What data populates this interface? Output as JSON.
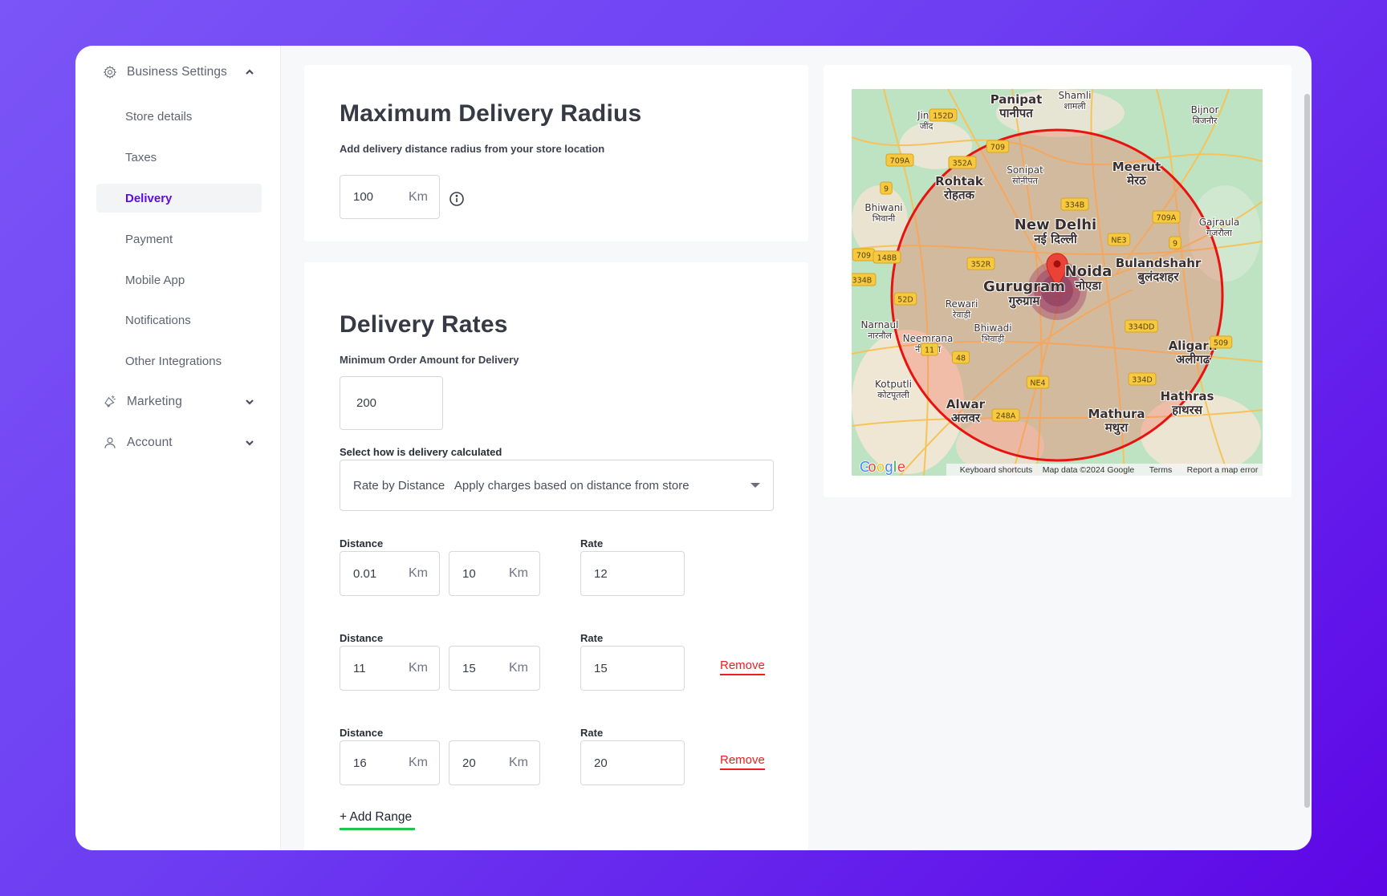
{
  "sidebar": {
    "groups": [
      {
        "label": "Business Settings",
        "icon": "gear-icon",
        "expanded": true
      },
      {
        "label": "Marketing",
        "icon": "megaphone-icon",
        "expanded": false
      },
      {
        "label": "Account",
        "icon": "user-icon",
        "expanded": false
      }
    ],
    "items": [
      {
        "label": "Store details",
        "active": false
      },
      {
        "label": "Taxes",
        "active": false
      },
      {
        "label": "Delivery",
        "active": true
      },
      {
        "label": "Payment",
        "active": false
      },
      {
        "label": "Mobile App",
        "active": false
      },
      {
        "label": "Notifications",
        "active": false
      },
      {
        "label": "Other Integrations",
        "active": false
      }
    ]
  },
  "radius_card": {
    "title": "Maximum Delivery Radius",
    "subtitle": "Add delivery distance radius from your store location",
    "radius_value": "100",
    "unit": "Km",
    "info_icon": "info-icon"
  },
  "rates_card": {
    "title": "Delivery Rates",
    "min_order_label": "Minimum Order Amount for Delivery",
    "min_order_value": "200",
    "calc_label": "Select how is delivery calculated",
    "calc_selected": "Rate by Distance   Apply charges based on distance from store",
    "distance_label": "Distance",
    "rate_label": "Rate",
    "unit": "Km",
    "remove_label": "Remove",
    "add_range_label": "+ Add Range",
    "ranges": [
      {
        "from": "0.01",
        "to": "10",
        "rate": "12",
        "removable": false
      },
      {
        "from": "11",
        "to": "15",
        "rate": "15",
        "removable": true
      },
      {
        "from": "16",
        "to": "20",
        "rate": "20",
        "removable": true
      }
    ]
  },
  "map": {
    "cities": [
      {
        "en": "Panipat",
        "hi": "पानीपत"
      },
      {
        "en": "Shamli",
        "hi": "शामली"
      },
      {
        "en": "Jind",
        "hi": "जींद"
      },
      {
        "en": "Bijnor",
        "hi": "बिजनौर"
      },
      {
        "en": "Sonipat",
        "hi": "सोनीपत"
      },
      {
        "en": "Rohtak",
        "hi": "रोहतक"
      },
      {
        "en": "Meerut",
        "hi": "मेरठ"
      },
      {
        "en": "Bhiwani",
        "hi": "भिवानी"
      },
      {
        "en": "New Delhi",
        "hi": "नई दिल्ली"
      },
      {
        "en": "Gajraula",
        "hi": "गजरौला"
      },
      {
        "en": "Noida",
        "hi": "नोएडा"
      },
      {
        "en": "Gurugram",
        "hi": "गुरुग्राम"
      },
      {
        "en": "Bulandshahr",
        "hi": "बुलंदशहर"
      },
      {
        "en": "Rewari",
        "hi": "रेवाड़ी"
      },
      {
        "en": "Narnaul",
        "hi": "नारनौल"
      },
      {
        "en": "Bhiwadi",
        "hi": "भिवाड़ी"
      },
      {
        "en": "Neemrana",
        "hi": "नीमराना"
      },
      {
        "en": "Aligarh",
        "hi": "अलीगढ"
      },
      {
        "en": "Kotputli",
        "hi": "कोटपूतली"
      },
      {
        "en": "Alwar",
        "hi": "अलवर"
      },
      {
        "en": "Hathras",
        "hi": "हाथरस"
      },
      {
        "en": "Mathura",
        "hi": "मथुरा"
      }
    ],
    "road_shields": [
      "152D",
      "709",
      "709A",
      "352A",
      "9",
      "334B",
      "NE3",
      "709A",
      "9",
      "709",
      "148B",
      "352R",
      "334B",
      "52D",
      "334DD",
      "509",
      "11",
      "48",
      "NE4",
      "334D",
      "248A"
    ],
    "logo": "Google",
    "footer": [
      "Keyboard shortcuts",
      "Map data ©2024 Google",
      "Terms",
      "Report a map error"
    ],
    "radius_circle_color": "#e8130f",
    "marker_color": "#ea4335"
  },
  "colors": {
    "accent": "#5b0ee0",
    "remove": "#f21c1c",
    "add_range_underline": "#1ec74a"
  }
}
